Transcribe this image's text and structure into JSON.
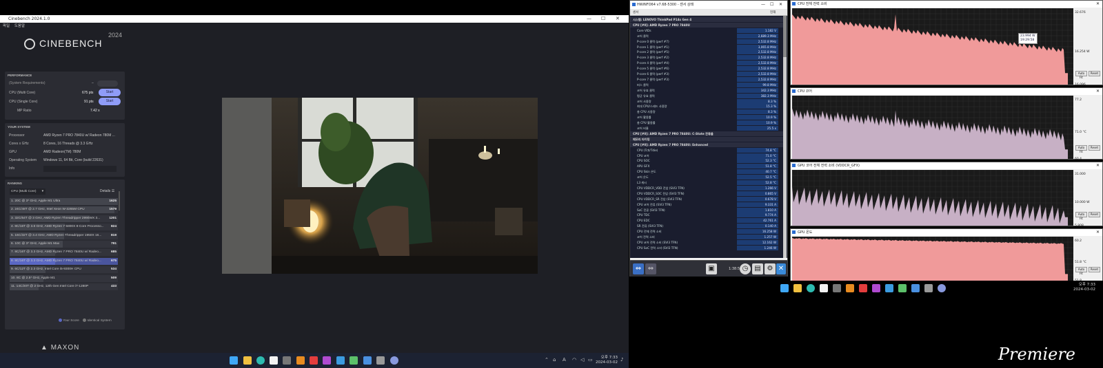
{
  "cinebench": {
    "window_title": "Cinebench 2024.1.0",
    "menu": [
      "파일",
      "도움말"
    ],
    "brand": "CINEBENCH",
    "year": "2024",
    "performance": {
      "heading": "PERFORMANCE",
      "sysreq": "(System Requirements)",
      "multi_label": "CPU (Multi Core)",
      "multi_score": "675 pts",
      "single_label": "CPU (Single Core)",
      "single_score": "91 pts",
      "mp_label": "MP Ratio",
      "mp_value": "7.42 x",
      "start": "Start",
      "dash": "–"
    },
    "system": {
      "heading": "YOUR SYSTEM",
      "rows": [
        {
          "label": "Processor",
          "value": "AMD Ryzen 7 PRO 7840U w/ Radeon 780M ..."
        },
        {
          "label": "Cores x GHz",
          "value": "8 Cores, 16 Threads @ 3.3 GHz"
        },
        {
          "label": "GPU",
          "value": "AMD Radeon(TM) 780M"
        },
        {
          "label": "Operating System",
          "value": "Windows 11, 64 Bit, Core (build 22631)"
        },
        {
          "label": "Info",
          "value": ""
        }
      ]
    },
    "ranking": {
      "heading": "RANKING",
      "select": "CPU (Multi Core)",
      "details": "Details",
      "items": [
        {
          "name": "1. 20C @ 3* GHz, Apple M1 Ultra",
          "score": "1625",
          "pct": 100,
          "me": false
        },
        {
          "name": "2. 24C/48T @ 2.7 GHz, Intel Xeon W-3265M CPU",
          "score": "1579",
          "pct": 97,
          "me": false
        },
        {
          "name": "3. 32C/64T @ 3 GHz, AMD Ryzen Threadripper 2990WX 3...",
          "score": "1201",
          "pct": 74,
          "me": false
        },
        {
          "name": "4. 8C/16T @ 3.8 GHz, AMD Ryzen 7 5800X 8-Core Processo...",
          "score": "824",
          "pct": 51,
          "me": false
        },
        {
          "name": "5. 16C/32T @ 3.4 GHz, AMD Ryzen Threadripper 1950X 16...",
          "score": "819",
          "pct": 50,
          "me": false
        },
        {
          "name": "6. 10C @ 3* GHz, Apple M1 Max",
          "score": "791",
          "pct": 49,
          "me": false
        },
        {
          "name": "7. 8C/16T @ 3.3 GHz, AMD Ryzen 7 PRO 7840U w/ Radeo...",
          "score": "685",
          "pct": 42,
          "me": false
        },
        {
          "name": "8. 8C/16T @ 3.3 GHz, AMD Ryzen 7 PRO 7840U w/ Radeo...",
          "score": "675",
          "pct": 42,
          "me": true
        },
        {
          "name": "9. 6C/12T @ 2.3 GHz, Intel Core i5-9300H CPU",
          "score": "534",
          "pct": 33,
          "me": false
        },
        {
          "name": "10. 8C @ 2.5* GHz, Apple M1",
          "score": "509",
          "pct": 31,
          "me": false
        },
        {
          "name": "11. 14C/20T @ 2 GHz, 12th Gen Intel Core i7-1280P",
          "score": "433",
          "pct": 27,
          "me": false
        }
      ],
      "legend_you": "Your Score",
      "legend_identical": "Identical System"
    },
    "footer": "MAXON"
  },
  "hwinfo": {
    "title": "HWiNFO64 v7.68-5300 - 센서 상태",
    "col_sensor": "센서",
    "col_value": "현재",
    "rows": [
      {
        "n": "시스템: LENOVO ThinkPad P14s Gen 4",
        "v": "",
        "g": true
      },
      {
        "n": "CPU [#0]: AMD Ryzen 7 PRO 7840U",
        "v": "",
        "g": true
      },
      {
        "n": "Core VIDs",
        "v": "1.182 V"
      },
      {
        "n": "코어 클럭",
        "v": "2,689.3 MHz"
      },
      {
        "n": "P-core 0 클럭 (perf #7)",
        "v": "2,532.8 MHz"
      },
      {
        "n": "P-core 1 클럭 (perf #1)",
        "v": "3,065.8 MHz"
      },
      {
        "n": "P-core 2 클럭 (perf #5)",
        "v": "2,532.8 MHz"
      },
      {
        "n": "P-core 3 클럭 (perf #2)",
        "v": "2,532.8 MHz"
      },
      {
        "n": "P-core 4 클럭 (perf #4)",
        "v": "2,532.8 MHz"
      },
      {
        "n": "P-core 5 클럭 (perf #6)",
        "v": "2,532.8 MHz"
      },
      {
        "n": "P-core 6 클럭 (perf #3)",
        "v": "2,532.8 MHz"
      },
      {
        "n": "P-core 7 클럭 (perf #3)",
        "v": "2,532.8 MHz"
      },
      {
        "n": "버스 클럭",
        "v": "99.8 MHz"
      },
      {
        "n": "코어 유효 클럭",
        "v": "342.3 MHz"
      },
      {
        "n": "평균 유효 클럭",
        "v": "382.3 MHz"
      },
      {
        "n": "코어 사용량",
        "v": "8.3 %"
      },
      {
        "n": "최대 CPU/스레드 사용량",
        "v": "15.3 %"
      },
      {
        "n": "총 CPU 사용량",
        "v": "8.3 %"
      },
      {
        "n": "코어 활용률",
        "v": "10.9 %"
      },
      {
        "n": "총 CPU 활용률",
        "v": "10.9 %"
      },
      {
        "n": "코어 비율",
        "v": "25.5 x"
      },
      {
        "n": "CPU [#0]: AMD Ryzen 7 PRO 7840U: C-State 잔류율",
        "v": "",
        "g": true
      },
      {
        "n": "메모리 타이밍",
        "v": "",
        "g": true
      },
      {
        "n": "CPU [#0]: AMD Ryzen 7 PRO 7840U: Enhanced",
        "v": "",
        "g": true
      },
      {
        "n": "CPU (Tctl/Tdie)",
        "v": "74.8 °C"
      },
      {
        "n": "CPU 코어",
        "v": "71.0 °C"
      },
      {
        "n": "CPU SOC",
        "v": "52.3 °C"
      },
      {
        "n": "APU GFX",
        "v": "51.8 °C"
      },
      {
        "n": "CPU Skin 온도",
        "v": "40.7 °C"
      },
      {
        "n": "코어 온도",
        "v": "52.5 °C"
      },
      {
        "n": "L3 캐시",
        "v": "52.8 °C"
      },
      {
        "n": "CPU VDDCR_VDD 전압 (SVI3 TFN)",
        "v": "1.266 V"
      },
      {
        "n": "CPU VDDCR_SOC 전압 (SVI3 TFN)",
        "v": "0.865 V"
      },
      {
        "n": "CPU VDDCR_SR 전압 (SVI3 TFN)",
        "v": "0.678 V"
      },
      {
        "n": "CPU 코어 전류 (SVI3 TFN)",
        "v": "9.331 A"
      },
      {
        "n": "SoC 전류 (SVI3 TFN)",
        "v": "1.810 A"
      },
      {
        "n": "CPU TDC",
        "v": "9.774 A"
      },
      {
        "n": "CPU EDC",
        "v": "42.761 A"
      },
      {
        "n": "SR 전류 (SVI3 TFN)",
        "v": "0.140 A"
      },
      {
        "n": "CPU 전체 전력 소비",
        "v": "16.258 W"
      },
      {
        "n": "코어 전력 소비",
        "v": "1.257 W"
      },
      {
        "n": "CPU 코어 전력 소비 (SVI3 TFN)",
        "v": "12.162 W"
      },
      {
        "n": "CPU SoC 전력 소비 (SVI3 TFN)",
        "v": "1.246 W"
      }
    ],
    "timer": "1:38:51"
  },
  "graphs": [
    {
      "title": "CPU 전체 전력 소비",
      "max": "32.676",
      "cur": "16.254 W",
      "min": "16.096",
      "tip1": "23.994 W",
      "tip2": "19:29:58"
    },
    {
      "title": "CPU 코어",
      "max": "77.2",
      "cur": "71.0 °C",
      "min": "60.4"
    },
    {
      "title": "GPU 코어 전체 전력 소비 (VDDCR_GFX)",
      "max": "31.000",
      "cur": "10.000 W",
      "min": "5.808"
    },
    {
      "title": "GPU 온도",
      "max": "60.2",
      "cur": "51.8 °C",
      "min": "51.8"
    }
  ],
  "graph_buttons": {
    "auto": "Auto Fit",
    "reset": "Reset"
  },
  "taskbar_left": {
    "time": "오후 7:33",
    "date": "2024-03-02",
    "sys": "A"
  },
  "taskbar_right": {
    "time": "오후 7:33",
    "date": "2024-03-02"
  },
  "watermark": "Premiere"
}
